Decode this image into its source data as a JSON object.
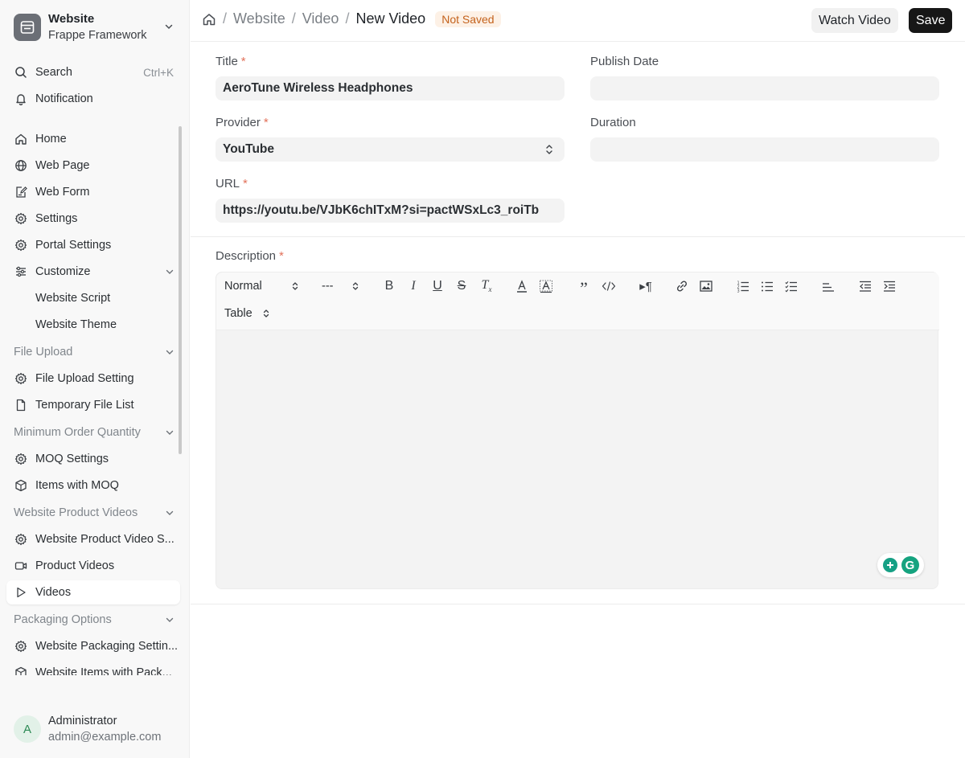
{
  "app": {
    "name": "Website",
    "subtitle": "Frappe Framework"
  },
  "sidebar": {
    "search": {
      "label": "Search",
      "shortcut": "Ctrl+K"
    },
    "notification": {
      "label": "Notification"
    },
    "items": [
      {
        "label": "Home",
        "icon": "home-icon"
      },
      {
        "label": "Web Page",
        "icon": "globe-icon"
      },
      {
        "label": "Web Form",
        "icon": "form-edit-icon"
      },
      {
        "label": "Settings",
        "icon": "gear-icon"
      },
      {
        "label": "Portal Settings",
        "icon": "gear-icon"
      },
      {
        "label": "Customize",
        "icon": "sliders-icon"
      },
      {
        "label": "Website Script"
      },
      {
        "label": "Website Theme"
      },
      {
        "label": "File Upload"
      },
      {
        "label": "File Upload Setting",
        "icon": "gear-icon"
      },
      {
        "label": "Temporary File List",
        "icon": "file-icon"
      },
      {
        "label": "Minimum Order Quantity"
      },
      {
        "label": "MOQ Settings",
        "icon": "gear-icon"
      },
      {
        "label": "Items with MOQ",
        "icon": "box-icon"
      },
      {
        "label": "Website Product Videos"
      },
      {
        "label": "Website Product Video S...",
        "icon": "gear-icon"
      },
      {
        "label": "Product Videos",
        "icon": "video-icon"
      },
      {
        "label": "Videos",
        "icon": "play-icon"
      },
      {
        "label": "Packaging Options"
      },
      {
        "label": "Website Packaging Settin...",
        "icon": "gear-icon"
      },
      {
        "label": "Website Items with Pack...",
        "icon": "box-icon"
      }
    ]
  },
  "user": {
    "initial": "A",
    "name": "Administrator",
    "email": "admin@example.com"
  },
  "header": {
    "breadcrumbs": [
      "Website",
      "Video",
      "New Video"
    ],
    "status": "Not Saved",
    "watch_label": "Watch Video",
    "save_label": "Save"
  },
  "form": {
    "title_label": "Title",
    "title_value": "AeroTune Wireless Headphones",
    "publish_date_label": "Publish Date",
    "publish_date_value": "",
    "provider_label": "Provider",
    "provider_value": "YouTube",
    "duration_label": "Duration",
    "duration_value": "",
    "url_label": "URL",
    "url_value": "https://youtu.be/VJbK6chITxM?si=pactWSxLc3_roiTb",
    "description_label": "Description"
  },
  "editor": {
    "heading_select": "Normal",
    "size_select": "---",
    "table_select": "Table"
  },
  "colors": {
    "accent": "#171717",
    "status_bg": "#fdf1e6",
    "status_fg": "#c4621c",
    "required": "#e2725b"
  }
}
